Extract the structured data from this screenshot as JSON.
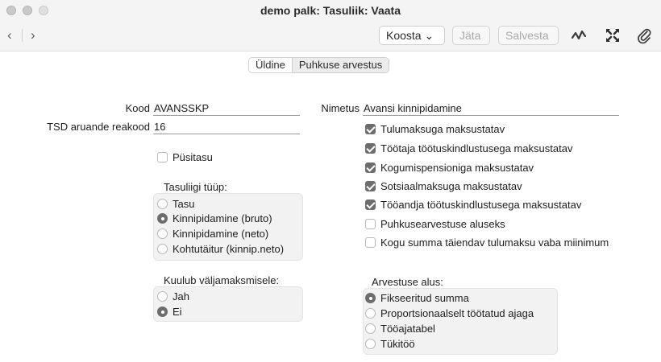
{
  "window": {
    "title": "demo palk: Tasuliik: Vaata"
  },
  "toolbar": {
    "back": "‹",
    "forward": "›",
    "create_label": "Koosta ⌄",
    "discard_label": "Jäta",
    "save_label": "Salvesta"
  },
  "tabs": [
    {
      "label": "Üldine",
      "active": true
    },
    {
      "label": "Puhkuse arvestus",
      "active": false
    }
  ],
  "form": {
    "code_label": "Kood",
    "code_value": "AVANSSKP",
    "tsd_label": "TSD aruande reakood",
    "tsd_value": "16",
    "name_label": "Nimetus",
    "name_value": "Avansi kinnipidamine",
    "permanent_label": "Püsitasu",
    "permanent_checked": false
  },
  "checkboxes": [
    {
      "label": "Tulumaksuga maksustatav",
      "checked": true
    },
    {
      "label": "Töötaja töötuskindlustusega maksustatav",
      "checked": true
    },
    {
      "label": "Kogumispensioniga maksustatav",
      "checked": true
    },
    {
      "label": "Sotsiaalmaksuga maksustatav",
      "checked": true
    },
    {
      "label": "Tööandja töötuskindlustusega maksustatav",
      "checked": true
    },
    {
      "label": "Puhkusearvestuse aluseks",
      "checked": false
    },
    {
      "label": "Kogu summa täiendav tulumaksu vaba miinimum",
      "checked": false
    }
  ],
  "type_group": {
    "label": "Tasuliigi tüüp:",
    "options": [
      "Tasu",
      "Kinnipidamine (bruto)",
      "Kinnipidamine (neto)",
      "Kohtutäitur (kinnip.neto)"
    ],
    "selected": 1
  },
  "payout_group": {
    "label": "Kuulub väljamaksmisele:",
    "options": [
      "Jah",
      "Ei"
    ],
    "selected": 1
  },
  "basis_group": {
    "label": "Arvestuse alus:",
    "options": [
      "Fikseeritud summa",
      "Proportsionaalselt töötatud ajaga",
      "Tööajatabel",
      "Tükitöö"
    ],
    "selected": 0
  },
  "colors": {
    "check_fill": "#6d6d6d",
    "chrome_bg": "#f4f4f4"
  }
}
